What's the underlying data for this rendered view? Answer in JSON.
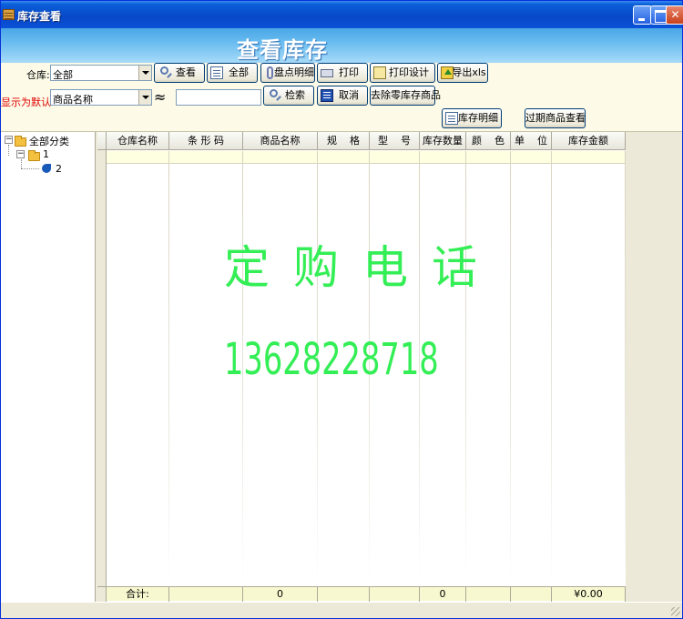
{
  "window": {
    "title": "库存查看",
    "banner_title": "查看库存"
  },
  "toolbar": {
    "warehouse_label": "仓库:",
    "warehouse_value": "全部",
    "display_label": "显示为默认:",
    "display_value": "商品名称",
    "approx_symbol": "≈",
    "search_value": "",
    "buttons": {
      "view": "查看",
      "all": "全部",
      "stock_detail": "盘点明细",
      "print": "打印",
      "print_design": "打印设计",
      "export_xls": "导出xls",
      "search": "检索",
      "cancel": "取消",
      "remove_zero": "去除零库存商品",
      "inventory_detail": "库存明细",
      "expired_goods": "过期商品查看"
    }
  },
  "tree": {
    "root": "全部分类",
    "child": "1",
    "leaf": "2"
  },
  "grid": {
    "columns": [
      "仓库名称",
      "条 形 码",
      "商品名称",
      "规    格",
      "型    号",
      "库存数量",
      "颜    色",
      "单    位",
      "库存金额"
    ],
    "footer": {
      "label": "合计:",
      "product_count": "0",
      "stock_qty": "0",
      "stock_amount": "¥0.00"
    }
  },
  "overlay": {
    "line1": "定购电话",
    "line2": "13628228718"
  },
  "colors": {
    "overlay_text": "#33ee55",
    "titlebar": "#0848c8",
    "banner": "#68bcf0",
    "warning_label": "#e00000"
  }
}
